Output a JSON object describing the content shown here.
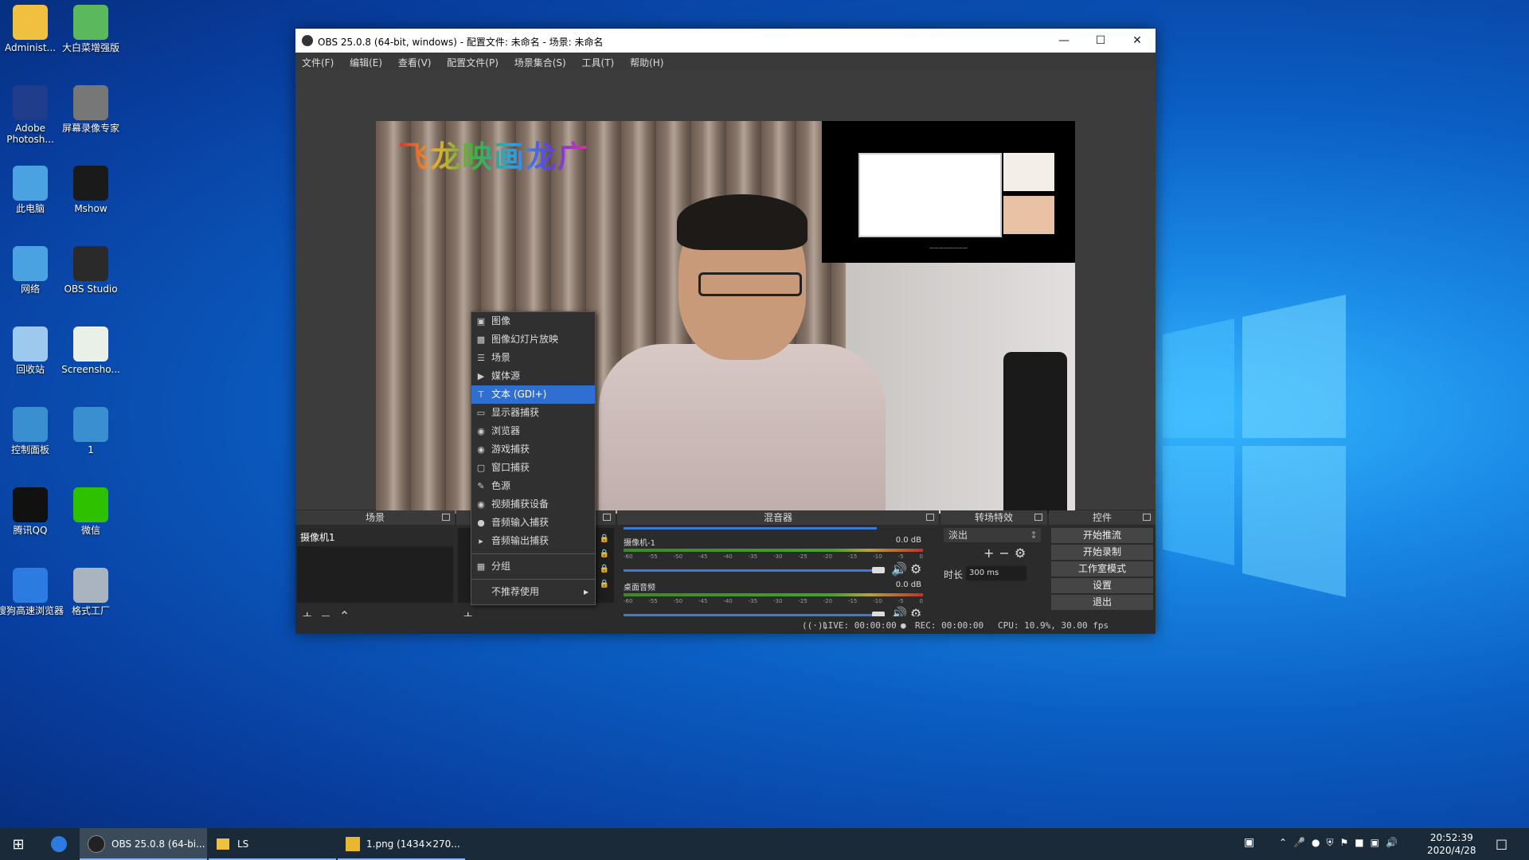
{
  "desktop": {
    "icons": [
      {
        "label": "Administ...",
        "icon": "user-folder-icon",
        "color": "#f0c040"
      },
      {
        "label": "大白菜增强版",
        "icon": "cabbage-icon",
        "color": "#5cb85c"
      },
      {
        "label": "Adobe Photosh...",
        "icon": "photoshop-icon",
        "color": "#1f3d8a"
      },
      {
        "label": "屏幕录像专家",
        "icon": "film-camera-icon",
        "color": "#777777"
      },
      {
        "label": "此电脑",
        "icon": "computer-icon",
        "color": "#4aa3e0"
      },
      {
        "label": "Mshow",
        "icon": "mshow-icon",
        "color": "#1a1a1a"
      },
      {
        "label": "网络",
        "icon": "network-icon",
        "color": "#4aa3e0"
      },
      {
        "label": "OBS Studio",
        "icon": "obs-icon",
        "color": "#2a2a2a"
      },
      {
        "label": "回收站",
        "icon": "recycle-bin-icon",
        "color": "#9ec9ef"
      },
      {
        "label": "Screensho...",
        "icon": "file-icon",
        "color": "#e8f0e8"
      },
      {
        "label": "控制面板",
        "icon": "control-panel-icon",
        "color": "#3a8fd0"
      },
      {
        "label": "1",
        "icon": "image-file-icon",
        "color": "#3a8fd0"
      },
      {
        "label": "腾讯QQ",
        "icon": "qq-icon",
        "color": "#111111"
      },
      {
        "label": "微信",
        "icon": "wechat-icon",
        "color": "#2dc100"
      },
      {
        "label": "搜狗高速浏览器",
        "icon": "sogou-browser-icon",
        "color": "#2b7be0"
      },
      {
        "label": "格式工厂",
        "icon": "format-factory-icon",
        "color": "#aab4c0"
      }
    ]
  },
  "obs": {
    "title": "OBS 25.0.8 (64-bit, windows) - 配置文件: 未命名 - 场景: 未命名",
    "menu": [
      "文件(F)",
      "编辑(E)",
      "查看(V)",
      "配置文件(P)",
      "场景集合(S)",
      "工具(T)",
      "帮助(H)"
    ],
    "overlay_title": "飞龙映画龙广",
    "docks": {
      "scenes": {
        "title": "场景",
        "items": [
          "摄像机1"
        ]
      },
      "mixer": {
        "title": "混音器",
        "channels": [
          {
            "name": "摄像机-1",
            "db": "0.0 dB"
          },
          {
            "name": "桌面音频",
            "db": "0.0 dB"
          }
        ],
        "ticks": [
          "-60",
          "-55",
          "-50",
          "-45",
          "-40",
          "-35",
          "-30",
          "-25",
          "-20",
          "-15",
          "-10",
          "-5",
          "0"
        ]
      },
      "transitions": {
        "title": "转场特效",
        "selected": "淡出",
        "duration_label": "时长",
        "duration_value": "300 ms"
      },
      "controls": {
        "title": "控件",
        "buttons": [
          "开始推流",
          "开始录制",
          "工作室模式",
          "设置",
          "退出"
        ]
      }
    },
    "status": {
      "live": "LIVE: 00:00:00",
      "rec": "REC: 00:00:00",
      "cpu": "CPU: 10.9%, 30.00 fps"
    },
    "context_menu": {
      "items": [
        {
          "label": "图像",
          "icon": "image-icon"
        },
        {
          "label": "图像幻灯片放映",
          "icon": "slideshow-icon"
        },
        {
          "label": "场景",
          "icon": "list-icon"
        },
        {
          "label": "媒体源",
          "icon": "play-icon"
        },
        {
          "label": "文本 (GDI+)",
          "icon": "text-icon",
          "selected": true
        },
        {
          "label": "显示器捕获",
          "icon": "monitor-icon"
        },
        {
          "label": "浏览器",
          "icon": "globe-icon"
        },
        {
          "label": "游戏捕获",
          "icon": "gamepad-icon"
        },
        {
          "label": "窗口捕获",
          "icon": "window-icon"
        },
        {
          "label": "色源",
          "icon": "brush-icon"
        },
        {
          "label": "视频捕获设备",
          "icon": "camera-icon"
        },
        {
          "label": "音频输入捕获",
          "icon": "microphone-icon"
        },
        {
          "label": "音频输出捕获",
          "icon": "speaker-icon"
        }
      ],
      "group": "分组",
      "deprecated": "不推荐使用"
    }
  },
  "taskbar": {
    "tasks": [
      {
        "label": "OBS 25.0.8 (64-bi...",
        "icon": "obs-icon"
      },
      {
        "label": "LS",
        "icon": "folder-icon"
      },
      {
        "label": "1.png (1434×270...",
        "icon": "image-viewer-icon"
      }
    ],
    "time": "20:52:39",
    "date": "2020/4/28"
  },
  "colors": {
    "accent": "#2f6fd1",
    "desktop": "#0b5fc4",
    "obs_bg": "#2b2b2b"
  }
}
